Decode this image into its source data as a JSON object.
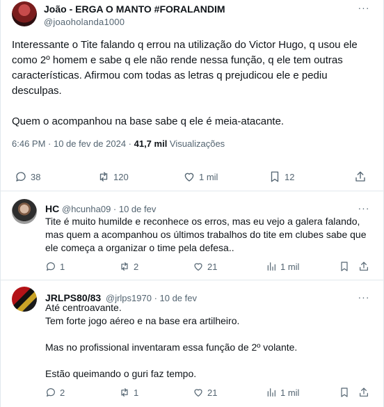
{
  "main": {
    "author_name": "João - ERGA O MANTO #FORALANDIM",
    "author_handle": "@joaoholanda1000",
    "paragraphs": [
      "Interessante o Tite falando q errou na utilização do Victor Hugo, q usou ele como 2º homem e sabe q ele não rende nessa função, q ele tem outras características. Afirmou com todas as letras q prejudicou ele e pediu desculpas.",
      "Quem o acompanhou na base sabe q ele é meia-atacante."
    ],
    "time": "6:46 PM · 10 de fev de 2024 · ",
    "views_count": "41,7 mil",
    "views_label": " Visualizações",
    "replies": "38",
    "reposts": "120",
    "likes": "1 mil",
    "bookmarks": "12"
  },
  "replies": [
    {
      "author_name": "HC",
      "author_handle": "@hcunha09 · 10 de fev",
      "paragraphs": [
        "Tite é muito humilde e reconhece os erros, mas eu vejo a galera falando, mas quem a acompanhou os últimos trabalhos do tite em clubes sabe que ele começa a organizar o time pela defesa.."
      ],
      "replies": "1",
      "reposts": "2",
      "likes": "21",
      "views": "1 mil"
    },
    {
      "author_name": "JRLPS80/83",
      "author_handle": "@jrlps1970 · 10 de fev",
      "paragraphs": [
        "Até centroavante.",
        "Tem forte jogo aéreo e na base era artilheiro.",
        "Mas no profissional inventaram essa função de 2º volante.",
        "Estão queimando o guri faz tempo."
      ],
      "replies": "2",
      "reposts": "1",
      "likes": "21",
      "views": "1 mil"
    }
  ],
  "icons": {
    "more": "more-dots-icon",
    "reply": "reply-bubble-icon",
    "repost": "repost-icon",
    "like": "heart-icon",
    "views": "views-bars-icon",
    "bookmark": "bookmark-icon",
    "share": "share-icon"
  }
}
